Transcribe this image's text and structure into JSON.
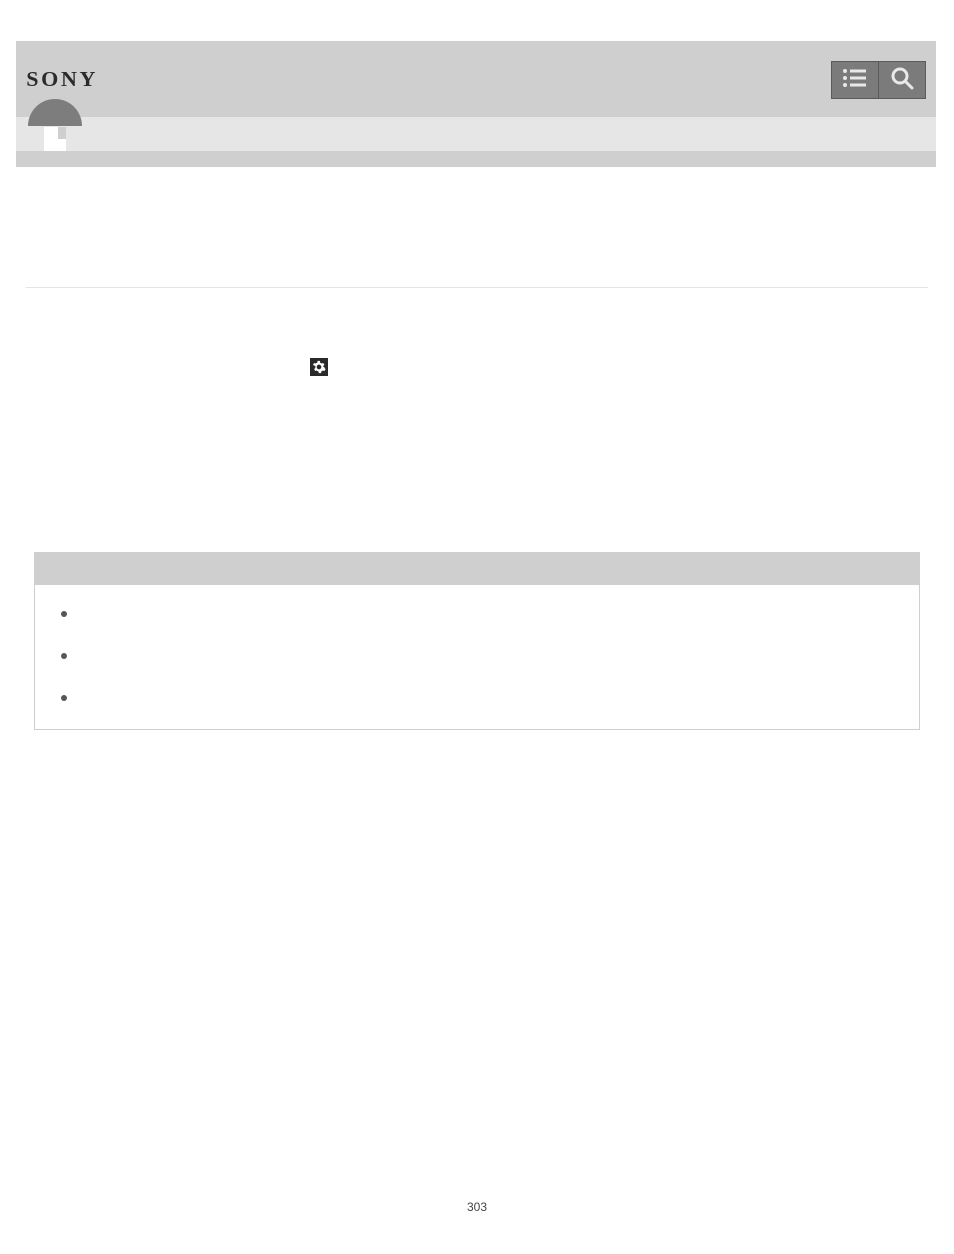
{
  "header": {
    "brand": "SONY"
  },
  "nav": {
    "burger_label": "Menu",
    "search_label": "Search"
  },
  "gear": {
    "label": "Settings"
  },
  "notes": {
    "heading": "",
    "items": [
      "",
      "",
      ""
    ]
  },
  "footer": {
    "page_number": "303"
  }
}
